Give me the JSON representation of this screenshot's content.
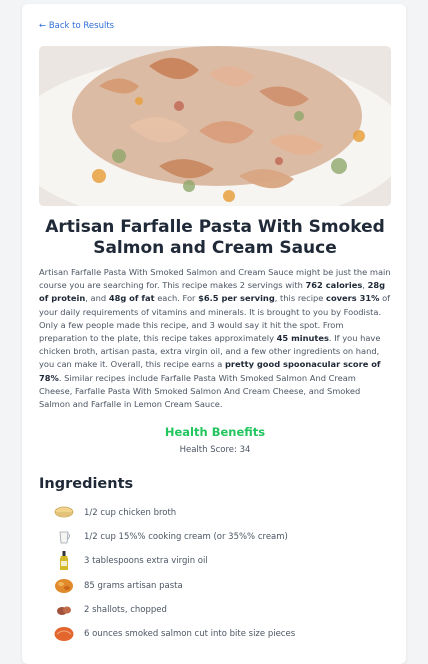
{
  "nav": {
    "back_label": "← Back to Results"
  },
  "recipe": {
    "title": "Artisan Farfalle Pasta With Smoked Salmon and Cream Sauce",
    "summary": [
      {
        "t": "Artisan Farfalle Pasta With Smoked Salmon and Cream Sauce might be just the main course you are searching for. This recipe makes 2 servings with "
      },
      {
        "t": "762 calories",
        "b": true
      },
      {
        "t": ", "
      },
      {
        "t": "28g of protein",
        "b": true
      },
      {
        "t": ", and "
      },
      {
        "t": "48g of fat",
        "b": true
      },
      {
        "t": " each. For "
      },
      {
        "t": "$6.5 per serving",
        "b": true
      },
      {
        "t": ", this recipe "
      },
      {
        "t": "covers 31%",
        "b": true
      },
      {
        "t": " of your daily requirements of vitamins and minerals. It is brought to you by Foodista. Only a few people made this recipe, and 3 would say it hit the spot. From preparation to the plate, this recipe takes approximately "
      },
      {
        "t": "45 minutes",
        "b": true
      },
      {
        "t": ". If you have chicken broth, artisan pasta, extra virgin oil, and a few other ingredients on hand, you can make it. Overall, this recipe earns a "
      },
      {
        "t": "pretty good spoonacular score of 78%",
        "b": true
      },
      {
        "t": ". Similar recipes include Farfalle Pasta With Smoked Salmon And Cream Cheese, Farfalle Pasta With Smoked Salmon And Cream Cheese, and Smoked Salmon and Farfalle in Lemon Cream Sauce."
      }
    ]
  },
  "health": {
    "heading": "Health Benefits",
    "score_text": "Health Score: 34"
  },
  "ingredients": {
    "heading": "Ingredients",
    "items": [
      {
        "icon": "broth-bowl-icon",
        "label": "1/2 cup chicken broth"
      },
      {
        "icon": "cream-pitcher-icon",
        "label": "1/2 cup 15%% cooking cream (or 35%% cream)"
      },
      {
        "icon": "olive-oil-bottle-icon",
        "label": "3 tablespoons extra virgin oil"
      },
      {
        "icon": "pasta-icon",
        "label": "85 grams artisan pasta"
      },
      {
        "icon": "shallot-icon",
        "label": "2 shallots, chopped"
      },
      {
        "icon": "smoked-salmon-icon",
        "label": "6 ounces smoked salmon cut into bite size pieces"
      }
    ]
  },
  "colors": {
    "accent_link": "#2f6fd6",
    "health_green": "#22c55e"
  }
}
